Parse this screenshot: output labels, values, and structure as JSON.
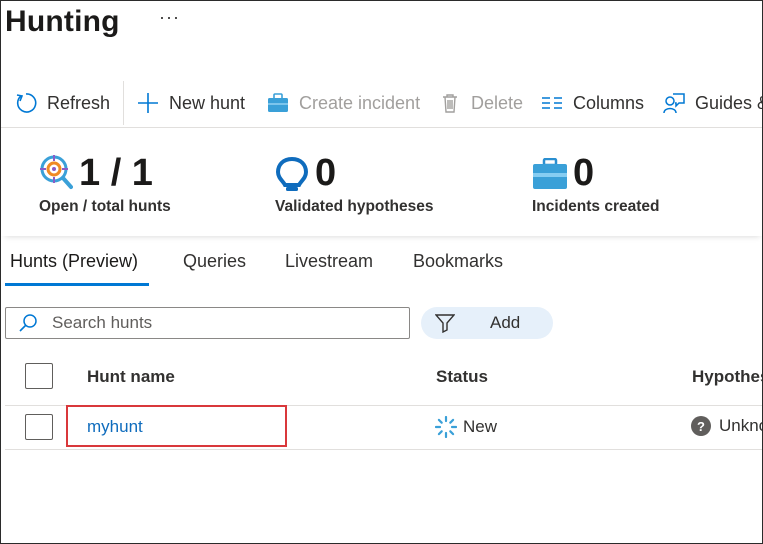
{
  "header": {
    "title": "Hunting",
    "more": "···"
  },
  "toolbar": {
    "refresh": "Refresh",
    "new_hunt": "New hunt",
    "create_incident": "Create incident",
    "delete": "Delete",
    "columns": "Columns",
    "guides": "Guides &"
  },
  "stats": {
    "hunts_value": "1 / 1",
    "hunts_label": "Open / total hunts",
    "hypotheses_value": "0",
    "hypotheses_label": "Validated hypotheses",
    "incidents_value": "0",
    "incidents_label": "Incidents created"
  },
  "tabs": [
    "Hunts (Preview)",
    "Queries",
    "Livestream",
    "Bookmarks"
  ],
  "search": {
    "placeholder": "Search hunts"
  },
  "filter": {
    "add_label": "Add"
  },
  "table": {
    "columns": [
      "Hunt name",
      "Status",
      "Hypothes"
    ],
    "rows": [
      {
        "name": "myhunt",
        "status": "New",
        "hypothesis": "Unkno"
      }
    ]
  },
  "colors": {
    "accent": "#0078d4",
    "link": "#0f6cbd",
    "highlight": "#d9383b"
  }
}
